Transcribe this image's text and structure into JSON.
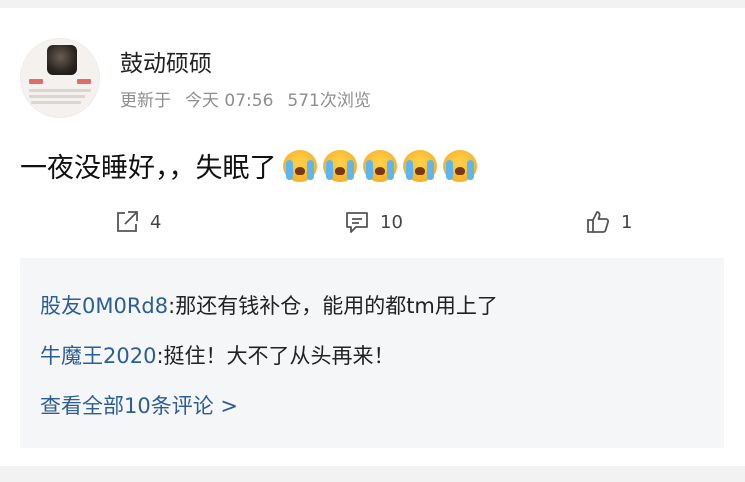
{
  "post": {
    "author": "鼓动硕硕",
    "updated_label": "更新于",
    "updated_time": "今天 07:56",
    "views": "571次浏览",
    "text": "一夜没睡好，，失眠了",
    "emoji": [
      "crying-face",
      "crying-face",
      "crying-face",
      "crying-face",
      "crying-face"
    ]
  },
  "actions": {
    "share_count": "4",
    "comment_count": "10",
    "like_count": "1"
  },
  "comments": {
    "items": [
      {
        "user": "股友0M0Rd8",
        "text": ":那还有钱补仓，能用的都tm用上了"
      },
      {
        "user": "牛魔王2020",
        "text": ":挺住！大不了从头再来！"
      }
    ],
    "view_all": "查看全部10条评论 >"
  },
  "colors": {
    "link_blue": "#2c5e95",
    "meta_gray": "#8e8e8e",
    "comment_bg": "#f5f6f8"
  }
}
